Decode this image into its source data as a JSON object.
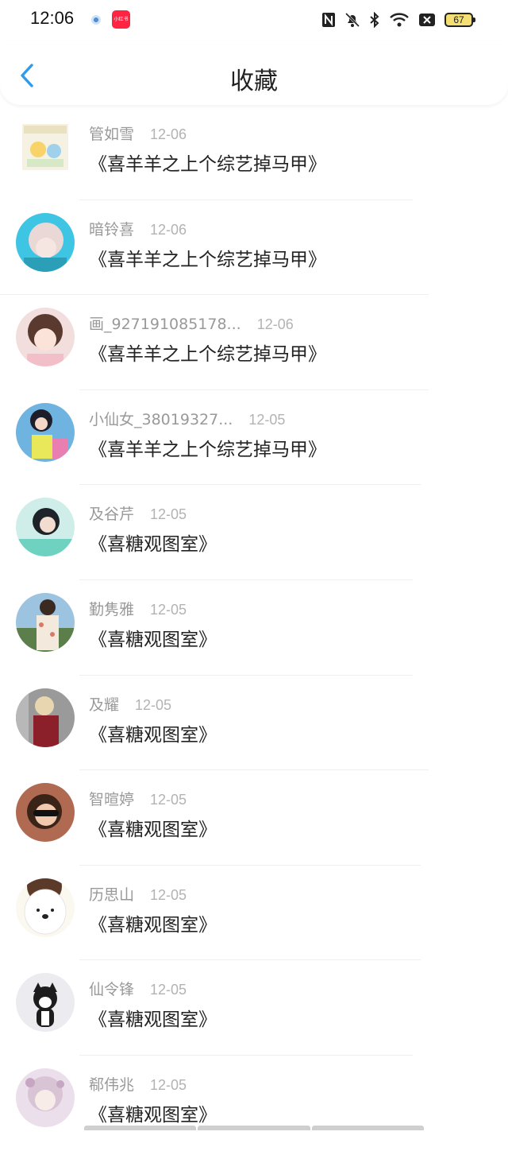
{
  "status_bar": {
    "time": "12:06",
    "app_badge": "小红书",
    "battery": "67",
    "icons": [
      "nfc-icon",
      "bell-off-icon",
      "bluetooth-icon",
      "wifi-icon",
      "sim-off-icon",
      "battery-icon"
    ]
  },
  "header": {
    "title": "收藏",
    "back_icon": "chevron-left-icon",
    "accent_color": "#2f9bea"
  },
  "items": [
    {
      "name": "管如雪",
      "date": "12-06",
      "book": "《喜羊羊之上个综艺掉马甲》",
      "avatar_style": "square"
    },
    {
      "name": "暗铃喜",
      "date": "12-06",
      "book": "《喜羊羊之上个综艺掉马甲》"
    },
    {
      "name": "画_927191085178...",
      "date": "12-06",
      "book": "《喜羊羊之上个综艺掉马甲》"
    },
    {
      "name": "小仙女_38019327...",
      "date": "12-05",
      "book": "《喜羊羊之上个综艺掉马甲》"
    },
    {
      "name": "及谷芹",
      "date": "12-05",
      "book": "《喜糖观图室》"
    },
    {
      "name": "勤隽雅",
      "date": "12-05",
      "book": "《喜糖观图室》"
    },
    {
      "name": "及耀",
      "date": "12-05",
      "book": "《喜糖观图室》"
    },
    {
      "name": "智暄婷",
      "date": "12-05",
      "book": "《喜糖观图室》"
    },
    {
      "name": "历思山",
      "date": "12-05",
      "book": "《喜糖观图室》"
    },
    {
      "name": "仙令锋",
      "date": "12-05",
      "book": "《喜糖观图室》"
    },
    {
      "name": "郗伟兆",
      "date": "12-05",
      "book": "《喜糖观图室》"
    }
  ]
}
